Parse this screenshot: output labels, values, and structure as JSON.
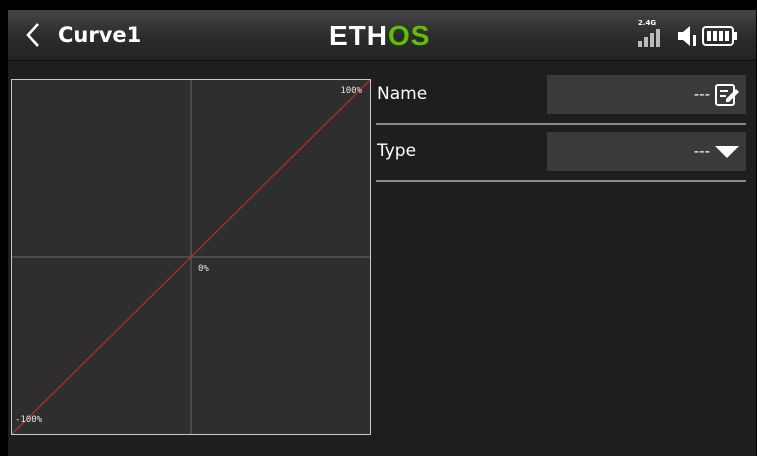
{
  "header": {
    "title": "Curve1",
    "logo_part1": "ETH",
    "logo_part2": "OS",
    "signal_label": "2.4G"
  },
  "chart": {
    "label_top_right": "100%",
    "label_center": "0%",
    "label_bottom_left": "-100%"
  },
  "chart_data": {
    "type": "line",
    "x": [
      -100,
      100
    ],
    "y": [
      -100,
      100
    ],
    "xlim": [
      -100,
      100
    ],
    "ylim": [
      -100,
      100
    ],
    "grid": true,
    "line_color": "#b3302c"
  },
  "fields": [
    {
      "label": "Name",
      "value": "---",
      "icon": "edit-icon"
    },
    {
      "label": "Type",
      "value": "---",
      "icon": "dropdown-arrow-icon"
    }
  ],
  "colors": {
    "accent": "#5fc000",
    "curve": "#b3302c"
  }
}
